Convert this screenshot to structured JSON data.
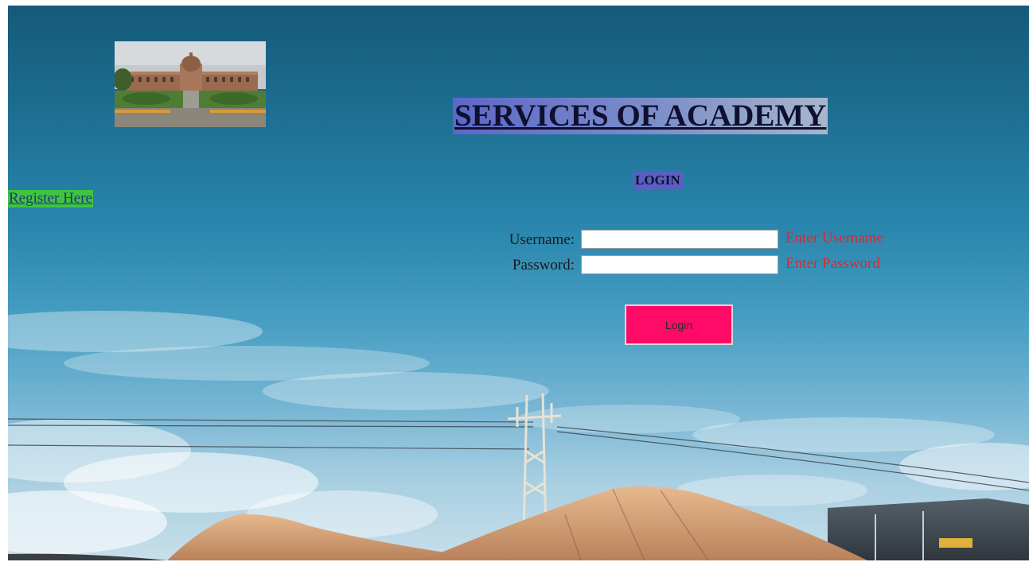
{
  "page": {
    "title": "SERVICES OF ACADEMY",
    "login_heading": "LOGIN",
    "register_link": "Register Here"
  },
  "form": {
    "username_label": "Username:",
    "username_value": "",
    "username_hint": "Enter Username",
    "password_label": "Password:",
    "password_value": "",
    "password_hint": "Enter Password",
    "submit_label": "Login"
  },
  "colors": {
    "register_bg": "#3fc43f",
    "title_bg": "#6c7ac8",
    "login_heading_bg": "#5a5fc2",
    "hint_text": "#e0262e",
    "button_bg": "#ff0a66"
  },
  "images": {
    "header_photo": "campus-building-photo",
    "background": "sky-with-power-pylon-and-sand-piles"
  }
}
